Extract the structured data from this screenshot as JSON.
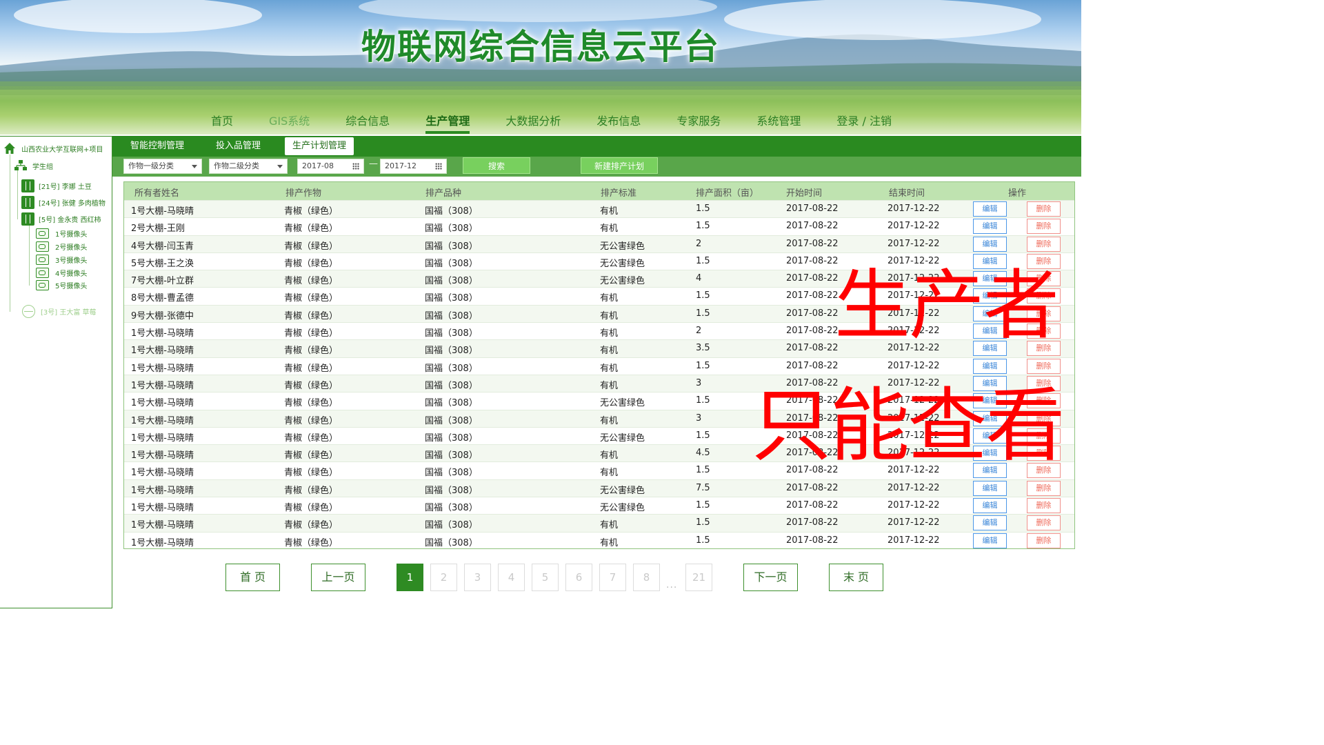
{
  "header": {
    "site_title": "物联网综合信息云平台",
    "nav": [
      "首页",
      "GIS系统",
      "综合信息",
      "生产管理",
      "大数据分析",
      "发布信息",
      "专家服务",
      "系统管理",
      "登录 / 注销"
    ],
    "active_nav": "生产管理"
  },
  "sidebar": {
    "root": "山西农业大学互联网+项目",
    "group": "学生组",
    "items": [
      "[21号] 李娜 土豆",
      "[24号] 张健 多肉植物",
      "[5号] 金永贵 西红柿"
    ],
    "cameras": [
      "1号摄像头",
      "2号摄像头",
      "3号摄像头",
      "4号摄像头",
      "5号摄像头"
    ],
    "offline_item": "[3号] 王大富 草莓"
  },
  "subtabs": [
    "智能控制管理",
    "投入品管理",
    "生产计划管理"
  ],
  "active_subtab": "生产计划管理",
  "filter": {
    "crop_level1": "作物一级分类",
    "crop_level2": "作物二级分类",
    "date_from": "2017-08",
    "date_separator": "—",
    "date_to": "2017-12",
    "search_label": "搜索",
    "new_plan_label": "新建排产计划"
  },
  "table": {
    "columns": [
      "所有者姓名",
      "排产作物",
      "排产品种",
      "排产标准",
      "排产面积（亩）",
      "开始时间",
      "结束时间",
      "操作"
    ],
    "edit_label": "编辑",
    "delete_label": "删除",
    "rows": [
      [
        "1号大棚-马晓晴",
        "青椒（绿色）",
        "国福（308）",
        "有机",
        "1.5",
        "2017-08-22",
        "2017-12-22"
      ],
      [
        "2号大棚-王刚",
        "青椒（绿色）",
        "国福（308）",
        "有机",
        "1.5",
        "2017-08-22",
        "2017-12-22"
      ],
      [
        "4号大棚-闫玉青",
        "青椒（绿色）",
        "国福（308）",
        "无公害绿色",
        "2",
        "2017-08-22",
        "2017-12-22"
      ],
      [
        "5号大棚-王之涣",
        "青椒（绿色）",
        "国福（308）",
        "无公害绿色",
        "1.5",
        "2017-08-22",
        "2017-12-22"
      ],
      [
        "7号大棚-叶立群",
        "青椒（绿色）",
        "国福（308）",
        "无公害绿色",
        "4",
        "2017-08-22",
        "2017-12-22"
      ],
      [
        "8号大棚-曹孟德",
        "青椒（绿色）",
        "国福（308）",
        "有机",
        "1.5",
        "2017-08-22",
        "2017-12-22"
      ],
      [
        "9号大棚-张德中",
        "青椒（绿色）",
        "国福（308）",
        "有机",
        "1.5",
        "2017-08-22",
        "2017-12-22"
      ],
      [
        "1号大棚-马晓晴",
        "青椒（绿色）",
        "国福（308）",
        "有机",
        "2",
        "2017-08-22",
        "2017-12-22"
      ],
      [
        "1号大棚-马晓晴",
        "青椒（绿色）",
        "国福（308）",
        "有机",
        "3.5",
        "2017-08-22",
        "2017-12-22"
      ],
      [
        "1号大棚-马晓晴",
        "青椒（绿色）",
        "国福（308）",
        "有机",
        "1.5",
        "2017-08-22",
        "2017-12-22"
      ],
      [
        "1号大棚-马晓晴",
        "青椒（绿色）",
        "国福（308）",
        "有机",
        "3",
        "2017-08-22",
        "2017-12-22"
      ],
      [
        "1号大棚-马晓晴",
        "青椒（绿色）",
        "国福（308）",
        "无公害绿色",
        "1.5",
        "2017-08-22",
        "2017-12-22"
      ],
      [
        "1号大棚-马晓晴",
        "青椒（绿色）",
        "国福（308）",
        "有机",
        "3",
        "2017-08-22",
        "2017-12-22"
      ],
      [
        "1号大棚-马晓晴",
        "青椒（绿色）",
        "国福（308）",
        "无公害绿色",
        "1.5",
        "2017-08-22",
        "2017-12-22"
      ],
      [
        "1号大棚-马晓晴",
        "青椒（绿色）",
        "国福（308）",
        "有机",
        "4.5",
        "2017-08-22",
        "2017-12-22"
      ],
      [
        "1号大棚-马晓晴",
        "青椒（绿色）",
        "国福（308）",
        "有机",
        "1.5",
        "2017-08-22",
        "2017-12-22"
      ],
      [
        "1号大棚-马晓晴",
        "青椒（绿色）",
        "国福（308）",
        "无公害绿色",
        "7.5",
        "2017-08-22",
        "2017-12-22"
      ],
      [
        "1号大棚-马晓晴",
        "青椒（绿色）",
        "国福（308）",
        "无公害绿色",
        "1.5",
        "2017-08-22",
        "2017-12-22"
      ],
      [
        "1号大棚-马晓晴",
        "青椒（绿色）",
        "国福（308）",
        "有机",
        "1.5",
        "2017-08-22",
        "2017-12-22"
      ],
      [
        "1号大棚-马晓晴",
        "青椒（绿色）",
        "国福（308）",
        "有机",
        "1.5",
        "2017-08-22",
        "2017-12-22"
      ]
    ]
  },
  "pagination": {
    "first_label": "首 页",
    "prev_label": "上一页",
    "pages": [
      "1",
      "2",
      "3",
      "4",
      "5",
      "6",
      "7",
      "8"
    ],
    "ellipsis": "...",
    "last_page": "21",
    "current_page": "1",
    "next_label": "下一页",
    "last_label": "末 页"
  },
  "overlay": {
    "line1": "生产者",
    "line2": "只能查看",
    "color": "#ff0000"
  },
  "colors": {
    "primary_green": "#2a8a20",
    "filter_green": "#59a64a",
    "button_green": "#78d05e",
    "header_row": "#bfe3b0",
    "edit_blue": "#3a86d8",
    "delete_red": "#ef6a5a"
  }
}
